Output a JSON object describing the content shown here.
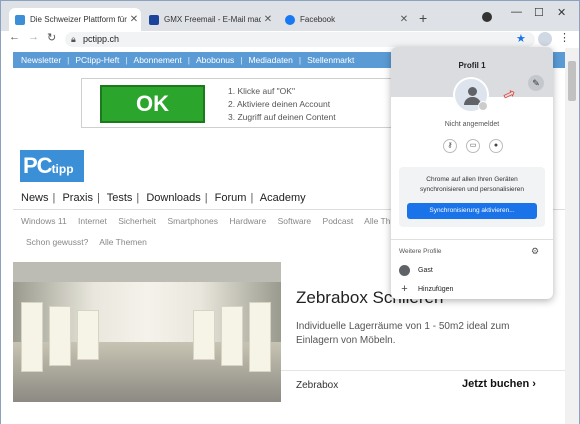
{
  "tabs": [
    {
      "title": "Die Schweizer Plattform für Com",
      "favicon_color": "#3a8fd6",
      "active": true
    },
    {
      "title": "GMX Freemail - E-Mail made in G",
      "favicon_color": "#1c449b",
      "active": false
    },
    {
      "title": "Facebook",
      "favicon_color": "#1877f2",
      "active": false
    }
  ],
  "toolbar": {
    "url": "pctipp.ch"
  },
  "site": {
    "topnav": [
      "Newsletter",
      "PCtipp-Heft",
      "Abonnement",
      "Abobonus",
      "Mediadaten",
      "Stellenmarkt"
    ],
    "ad": {
      "button": "OK",
      "steps": [
        "1. Klicke auf \"OK\"",
        "2. Aktiviere deinen Account",
        "3. Zugriff auf deinen Content"
      ]
    },
    "logo": {
      "main": "PC",
      "sub": "tipp"
    },
    "mainnav": [
      "News",
      "Praxis",
      "Tests",
      "Downloads",
      "Forum",
      "Academy"
    ],
    "subnav": [
      "Windows 11",
      "Internet",
      "Sicherheit",
      "Smartphones",
      "Hardware",
      "Software",
      "Podcast",
      "Alle Th"
    ],
    "subnav2": [
      "Schon gewusst?",
      "Alle Themen"
    ],
    "promo": {
      "title": "Zebrabox Schlieren",
      "description": "Individuelle Lagerräume von 1 - 50m2 ideal zum Einlagern von Möbeln.",
      "brand": "Zebrabox",
      "cta": "Jetzt buchen"
    }
  },
  "profile_popup": {
    "title": "Profil 1",
    "status": "Nicht angemeldet",
    "sync_text": "Chrome auf allen Ihren Geräten synchronisieren und personalisieren",
    "sync_button": "Synchronisierung aktivieren...",
    "other_profiles_label": "Weitere Profile",
    "guest": "Gast",
    "add": "Hinzufügen"
  },
  "colors": {
    "accent": "#1a73e8",
    "topnav_bg": "#5b9bd5",
    "ok_green": "#2ba52b",
    "annotation_arrow": "#e03c31"
  }
}
